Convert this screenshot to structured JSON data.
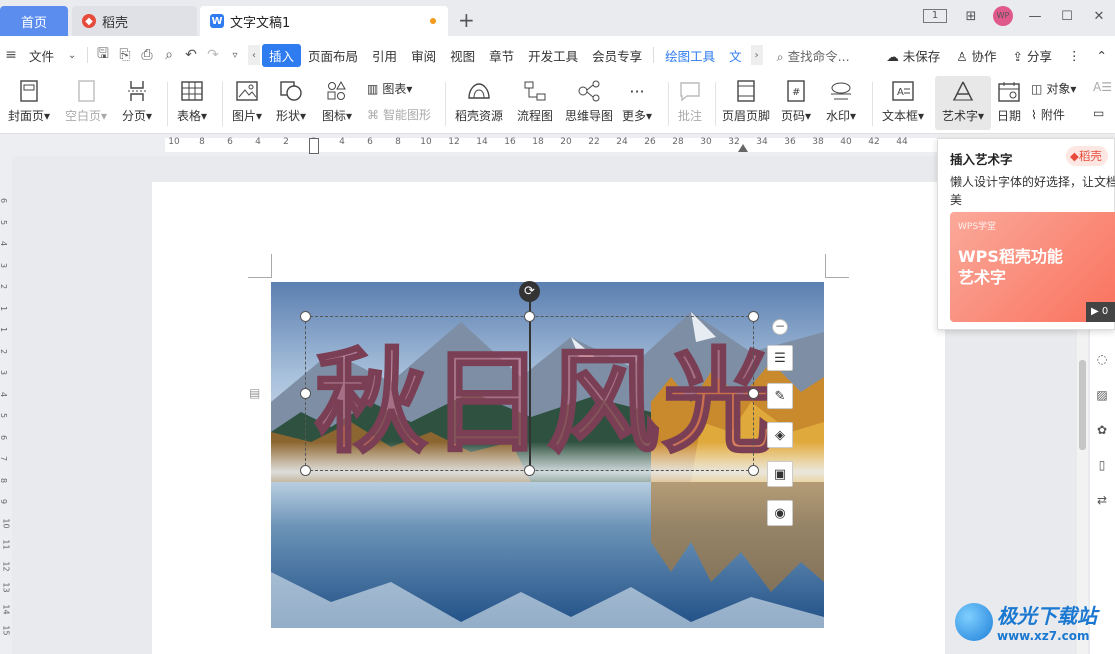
{
  "tabs": {
    "home": "首页",
    "docer": "稻壳",
    "doc": "文字文稿1",
    "add": "+"
  },
  "window": {
    "layout_badge": "1",
    "avatar": "WP",
    "minimize": "—",
    "maximize": "☐",
    "close": "✕"
  },
  "menu": {
    "file": "文件",
    "items": [
      "插入",
      "页面布局",
      "引用",
      "审阅",
      "视图",
      "章节",
      "开发工具",
      "会员专享"
    ],
    "drawing_tools": "绘图工具",
    "text_cut": "文",
    "search": "查找命令...",
    "unsaved": "未保存",
    "collab": "协作",
    "share": "分享"
  },
  "ribbon": {
    "cover_page": "封面页",
    "blank_page": "空白页",
    "page_break": "分页",
    "table": "表格",
    "picture": "图片",
    "shape": "形状",
    "icon": "图标",
    "chart": "图表",
    "smart_shape": "智能图形",
    "docer_resources": "稻壳资源",
    "flowchart": "流程图",
    "mind_map": "思维导图",
    "more": "更多",
    "comment": "批注",
    "header_footer": "页眉页脚",
    "page_number": "页码",
    "watermark": "水印",
    "text_box": "文本框",
    "art_word": "艺术字",
    "date": "日期",
    "object": "对象",
    "attachment": "附件"
  },
  "ruler": {
    "h_ticks": [
      "10",
      "8",
      "6",
      "4",
      "2",
      "2",
      "4",
      "6",
      "8",
      "10",
      "12",
      "14",
      "16",
      "18",
      "20",
      "22",
      "24",
      "26",
      "28",
      "30",
      "32",
      "34",
      "36",
      "38",
      "40",
      "42",
      "44"
    ],
    "v_ticks": [
      "6",
      "5",
      "4",
      "3",
      "2",
      "1",
      "1",
      "2",
      "3",
      "4",
      "5",
      "6",
      "7",
      "8",
      "9",
      "10",
      "11",
      "12",
      "13",
      "14",
      "15"
    ]
  },
  "document": {
    "art_text": [
      "秋",
      "日",
      "风",
      "光"
    ]
  },
  "tooltip": {
    "title": "插入艺术字",
    "badge": "稻壳",
    "desc_line1": "懒人设计字体的好选择，让文档更",
    "desc_line2": "美",
    "card_small": "WPS学堂",
    "card_title_1": "WPS稻壳功能",
    "card_title_2": "艺术字",
    "play": "0"
  },
  "watermark_site": {
    "name": "极光下载站",
    "url": "www.xz7.com"
  }
}
